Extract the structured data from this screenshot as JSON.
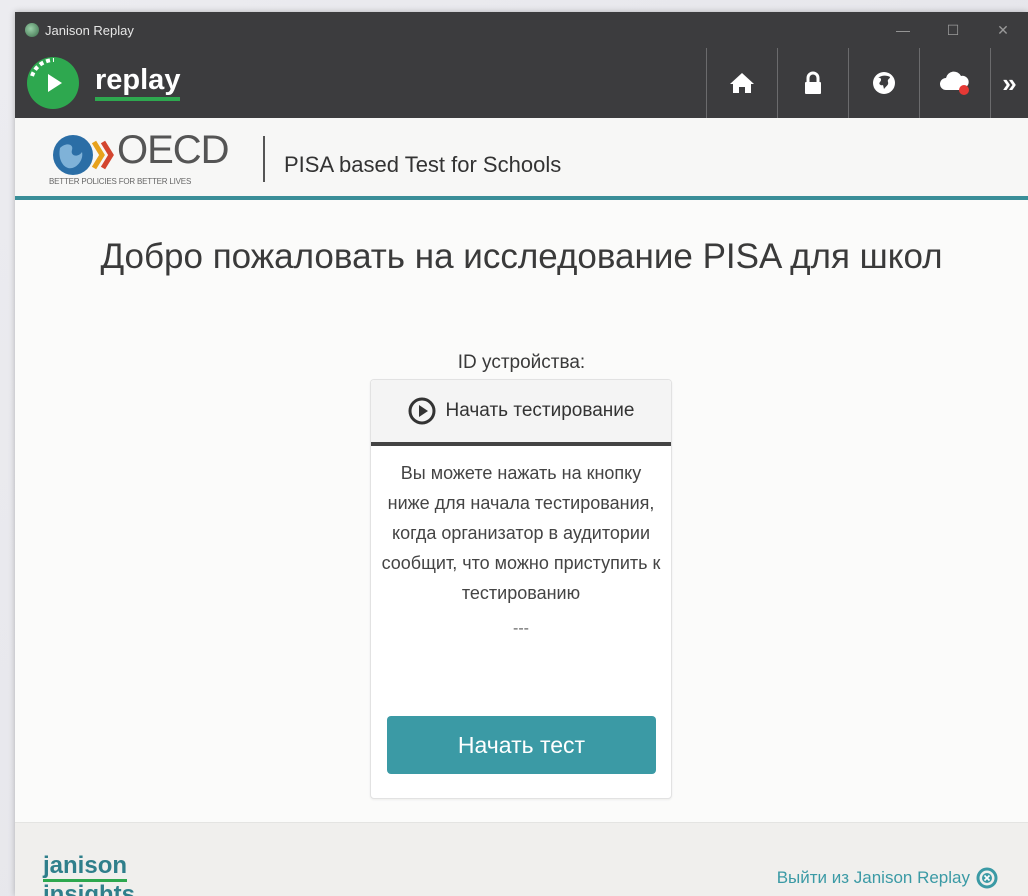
{
  "window": {
    "title": "Janison Replay",
    "controls": {
      "minimize": "—",
      "maximize": "☐",
      "close": "✕"
    }
  },
  "header": {
    "logo_text": "replay",
    "icons": [
      "home-icon",
      "lock-icon",
      "globe-icon",
      "cloud-icon",
      "more-icon"
    ],
    "more_glyph": "»"
  },
  "oecd": {
    "wordmark": "OECD",
    "tagline": "BETTER POLICIES FOR BETTER LIVES",
    "subtitle": "PISA based Test for Schools"
  },
  "main": {
    "title": "Добро пожаловать на исследование PISA для школ",
    "device_id_label": "ID устройства:"
  },
  "card": {
    "header_label": "Начать тестирование",
    "body_text": "Вы можете нажать на кнопку ниже для начала тестирования, когда организатор в аудитории сообщит, что можно приступить к тестированию",
    "dashes": "---",
    "start_button": "Начать тест"
  },
  "footer": {
    "brand_line1": "janison",
    "brand_line2": "insights",
    "exit_link": "Выйти из Janison Replay"
  },
  "colors": {
    "header_bg": "#3c3c3e",
    "accent_green": "#2ea84f",
    "accent_teal": "#3b9aa5"
  }
}
